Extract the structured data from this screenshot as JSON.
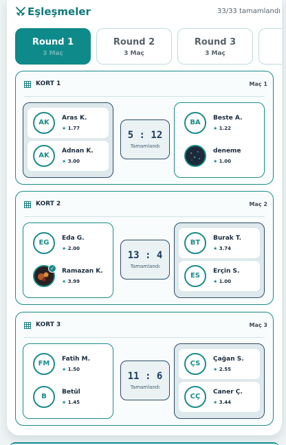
{
  "header": {
    "title": "Eşleşmeler",
    "count": "33/33 tamamlandı",
    "icon": "crossed-swords-icon"
  },
  "tabs": [
    {
      "label": "Round 1",
      "sub": "3 Maç",
      "active": true
    },
    {
      "label": "Round 2",
      "sub": "3 Maç",
      "active": false
    },
    {
      "label": "Round 3",
      "sub": "3 Maç",
      "active": false
    }
  ],
  "courts": [
    {
      "name": "KORT 1",
      "match": "Maç 1",
      "score": "5 : 12",
      "status": "Tamamlandı",
      "winner": "right",
      "left": [
        {
          "initials": "AK",
          "name": "Aras K.",
          "rating": "1.77"
        },
        {
          "initials": "AK",
          "name": "Adnan K.",
          "rating": "3.00"
        }
      ],
      "right": [
        {
          "initials": "BA",
          "name": "Beste A.",
          "rating": "1.22"
        },
        {
          "initials": "",
          "name": "deneme",
          "rating": "1.00",
          "photo": true
        }
      ]
    },
    {
      "name": "KORT 2",
      "match": "Maç 2",
      "score": "13 : 4",
      "status": "Tamamlandı",
      "winner": "left",
      "left": [
        {
          "initials": "EG",
          "name": "Eda G.",
          "rating": "2.00"
        },
        {
          "initials": "",
          "name": "Ramazan K.",
          "rating": "3.99",
          "photo": true,
          "verified": true
        }
      ],
      "right": [
        {
          "initials": "BT",
          "name": "Burak T.",
          "rating": "3.74"
        },
        {
          "initials": "ES",
          "name": "Erçin S.",
          "rating": "1.00"
        }
      ]
    },
    {
      "name": "KORT 3",
      "match": "Maç 3",
      "score": "11 : 6",
      "status": "Tamamlandı",
      "winner": "left",
      "left": [
        {
          "initials": "FM",
          "name": "Fatih M.",
          "rating": "1.50"
        },
        {
          "initials": "B",
          "name": "Betül",
          "rating": "1.45"
        }
      ],
      "right": [
        {
          "initials": "ÇS",
          "name": "Çağan S.",
          "rating": "2.55"
        },
        {
          "initials": "CÇ",
          "name": "Caner Ç.",
          "rating": "3.44"
        }
      ]
    }
  ],
  "colors": {
    "accent": "#0f8a8a",
    "winner_border": "#2e4a66"
  }
}
